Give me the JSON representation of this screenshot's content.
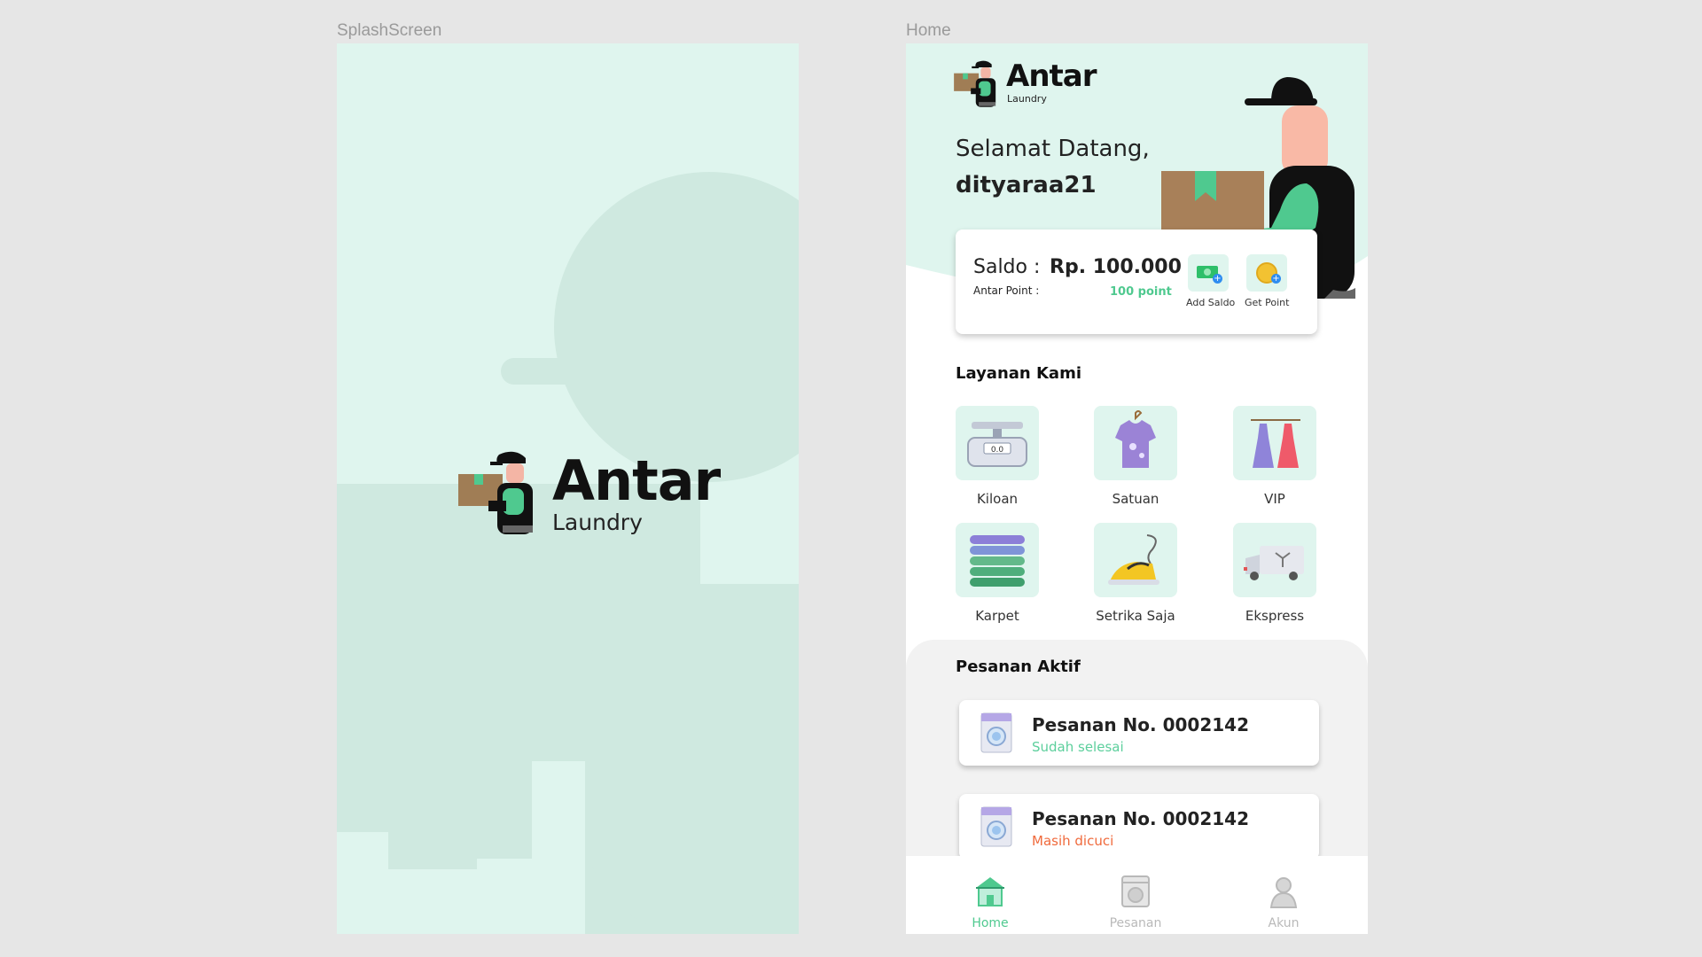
{
  "canvas": {
    "splash_label": "SplashScreen",
    "home_label": "Home"
  },
  "splash": {
    "logo_title": "Antar",
    "logo_subtitle": "Laundry"
  },
  "home": {
    "logo_title": "Antar",
    "logo_subtitle": "Laundry",
    "greeting": "Selamat Datang,",
    "username": "dityaraa21",
    "balance": {
      "saldo_label": "Saldo :",
      "saldo_value": "Rp. 100.000",
      "point_label": "Antar Point :",
      "point_value": "100 point",
      "add_saldo_label": "Add Saldo",
      "get_point_label": "Get Point"
    },
    "services_heading": "Layanan Kami",
    "services": [
      {
        "label": "Kiloan",
        "icon": "scale-icon"
      },
      {
        "label": "Satuan",
        "icon": "tshirt-icon"
      },
      {
        "label": "VIP",
        "icon": "dress-icon"
      },
      {
        "label": "Karpet",
        "icon": "carpet-stack-icon"
      },
      {
        "label": "Setrika Saja",
        "icon": "iron-icon"
      },
      {
        "label": "Ekspress",
        "icon": "delivery-van-icon"
      }
    ],
    "orders_heading": "Pesanan Aktif",
    "orders": [
      {
        "title": "Pesanan No. 0002142",
        "status": "Sudah selesai",
        "status_color": "#5ccf9c"
      },
      {
        "title": "Pesanan No. 0002142",
        "status": "Masih dicuci",
        "status_color": "#f06a3c"
      }
    ],
    "nav": [
      {
        "label": "Home",
        "icon": "home-store-icon",
        "active": true
      },
      {
        "label": "Pesanan",
        "icon": "washing-machine-icon",
        "active": false
      },
      {
        "label": "Akun",
        "icon": "user-icon",
        "active": false
      }
    ]
  },
  "colors": {
    "mint_bg": "#dff5ee",
    "accent_green": "#4fc98f",
    "success": "#5ccf9c",
    "warning": "#f06a3c",
    "inactive": "#b9b9b9"
  }
}
